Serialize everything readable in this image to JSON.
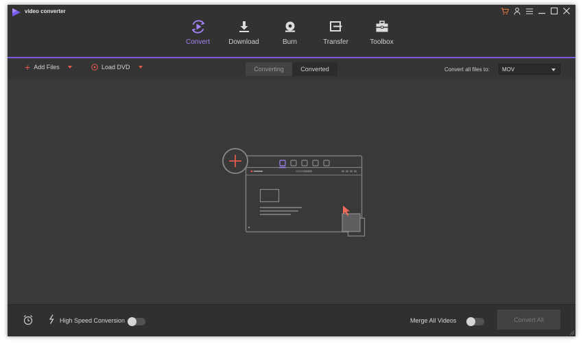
{
  "app": {
    "title": "video converter",
    "logo_icon": "play-logo-icon"
  },
  "window_controls": [
    {
      "name": "cart-icon"
    },
    {
      "name": "user-icon"
    },
    {
      "name": "menu-icon"
    },
    {
      "name": "minimize-icon"
    },
    {
      "name": "maximize-icon"
    },
    {
      "name": "close-icon"
    }
  ],
  "nav": {
    "tabs": [
      {
        "label": "Convert",
        "icon": "convert-icon",
        "active": true
      },
      {
        "label": "Download",
        "icon": "download-icon",
        "active": false
      },
      {
        "label": "Burn",
        "icon": "burn-icon",
        "active": false
      },
      {
        "label": "Transfer",
        "icon": "transfer-icon",
        "active": false
      },
      {
        "label": "Toolbox",
        "icon": "toolbox-icon",
        "active": false
      }
    ]
  },
  "toolbar": {
    "add_files": "Add Files",
    "load_dvd": "Load DVD",
    "segments": {
      "converting": "Converting",
      "converted": "Converted"
    },
    "convert_all_label": "Convert all files to:",
    "format": "MOV"
  },
  "footer": {
    "high_speed_label": "High Speed Conversion",
    "high_speed_on": false,
    "merge_label": "Merge All Videos",
    "merge_on": false,
    "convert_all_button": "Convert All"
  },
  "colors": {
    "accent": "#a383f5",
    "tab_underline": "#7a5be0",
    "red_accent": "#e55a4a",
    "background": "#3a3939"
  }
}
